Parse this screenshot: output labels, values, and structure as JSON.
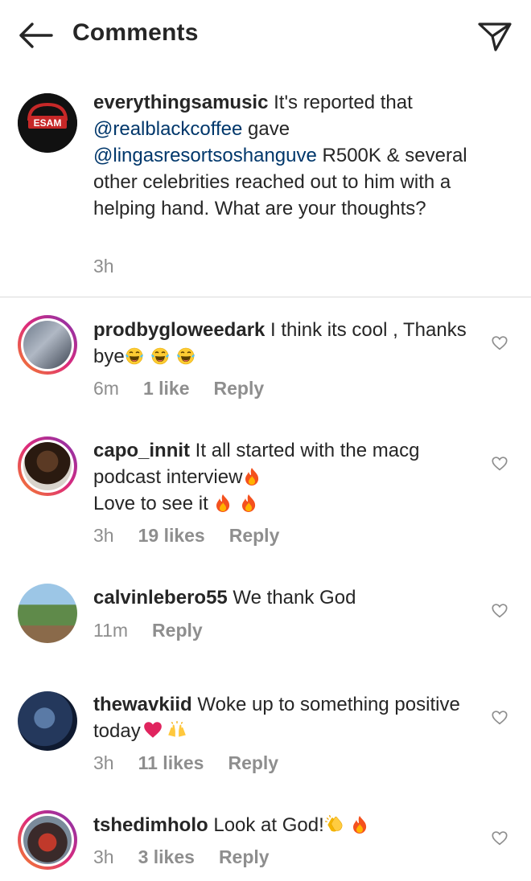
{
  "header": {
    "title": "Comments",
    "back_icon": "arrow-left-icon",
    "send_icon": "paper-plane-icon"
  },
  "caption": {
    "username": "everythingsamusic",
    "text_1": " It's reported that ",
    "mention_1": "@realblackcoffee",
    "text_2": " gave ",
    "mention_2": "@lingasresortsoshanguve",
    "text_3": " R500K & several other celebrities reached out to him with a helping hand. What are your thoughts?",
    "time": "3h",
    "avatar_label": "ESAM"
  },
  "comments": [
    {
      "username": "prodbygloweedark",
      "text": " I think its cool , Thanks bye",
      "emojis": [
        "tears-of-joy",
        "tears-of-joy",
        "tears-of-joy"
      ],
      "time": "6m",
      "likes": "1 like",
      "reply": "Reply"
    },
    {
      "username": "capo_innit",
      "text_1": " It all started with the macg podcast interview",
      "text_2": "Love to see it ",
      "emojis": [
        "fire",
        "fire",
        "fire"
      ],
      "time": "3h",
      "likes": "19 likes",
      "reply": "Reply"
    },
    {
      "username": "calvinlebero55",
      "text": " We thank God",
      "time": "11m",
      "reply": "Reply"
    },
    {
      "username": "thewavkiid",
      "text": " Woke up to something positive today",
      "emojis": [
        "red-heart",
        "raising-hands"
      ],
      "time": "3h",
      "likes": "11 likes",
      "reply": "Reply"
    },
    {
      "username": "tshedimholo",
      "text": " Look at God!",
      "emojis": [
        "clapping-hands",
        "fire"
      ],
      "time": "3h",
      "likes": "3 likes",
      "reply": "Reply"
    }
  ],
  "colors": {
    "text": "#262626",
    "meta": "#8e8e8e",
    "mention": "#00376b",
    "divider": "#dbdbdb"
  }
}
